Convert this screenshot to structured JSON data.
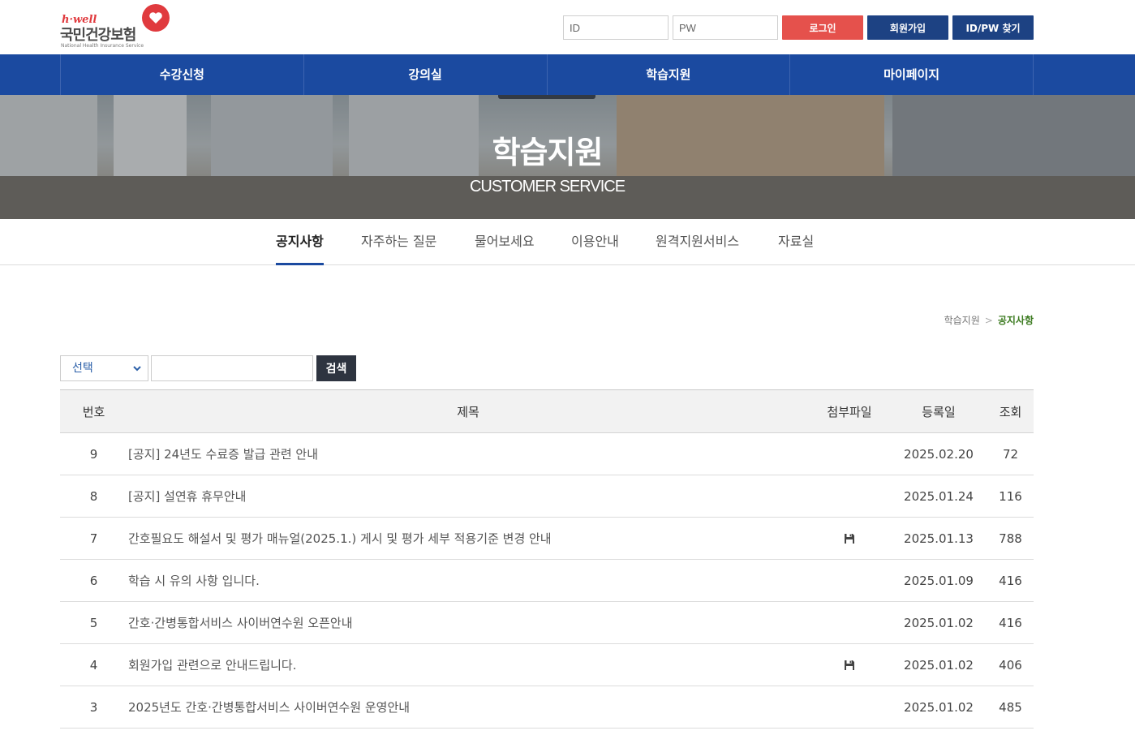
{
  "logo": {
    "brand": "h·well",
    "name": "국민건강보험",
    "sub": "National Health Insurance Service"
  },
  "login": {
    "id_placeholder": "ID",
    "pw_placeholder": "PW",
    "login_label": "로그인",
    "signup_label": "회원가입",
    "find_label": "ID/PW 찾기"
  },
  "gnb": {
    "items": [
      {
        "label": "수강신청"
      },
      {
        "label": "강의실"
      },
      {
        "label": "학습지원"
      },
      {
        "label": "마이페이지"
      }
    ]
  },
  "banner": {
    "title": "학습지원",
    "subtitle": "CUSTOMER SERVICE"
  },
  "subtabs": {
    "items": [
      {
        "label": "공지사항",
        "active": true
      },
      {
        "label": "자주하는 질문"
      },
      {
        "label": "물어보세요"
      },
      {
        "label": "이용안내"
      },
      {
        "label": "원격지원서비스"
      },
      {
        "label": "자료실"
      }
    ]
  },
  "breadcrumb": {
    "parent": "학습지원",
    "separator": ">",
    "current": "공지사항"
  },
  "search": {
    "select_value": "선택",
    "input_value": "",
    "button_label": "검색"
  },
  "table": {
    "headers": {
      "no": "번호",
      "title": "제목",
      "file": "첨부파일",
      "date": "등록일",
      "views": "조회"
    },
    "rows": [
      {
        "no": "9",
        "title": "[공지] 24년도 수료증 발급 관련 안내",
        "has_file": false,
        "date": "2025.02.20",
        "views": "72"
      },
      {
        "no": "8",
        "title": "[공지] 설연휴 휴무안내",
        "has_file": false,
        "date": "2025.01.24",
        "views": "116"
      },
      {
        "no": "7",
        "title": "간호필요도 해설서 및 평가 매뉴얼(2025.1.) 게시 및 평가 세부 적용기준 변경 안내",
        "has_file": true,
        "date": "2025.01.13",
        "views": "788"
      },
      {
        "no": "6",
        "title": "학습 시 유의 사항 입니다.",
        "has_file": false,
        "date": "2025.01.09",
        "views": "416"
      },
      {
        "no": "5",
        "title": "간호·간병통합서비스 사이버연수원 오픈안내",
        "has_file": false,
        "date": "2025.01.02",
        "views": "416"
      },
      {
        "no": "4",
        "title": "회원가입 관련으로 안내드립니다.",
        "has_file": true,
        "date": "2025.01.02",
        "views": "406"
      },
      {
        "no": "3",
        "title": "2025년도 간호·간병통합서비스 사이버연수원 운영안내",
        "has_file": false,
        "date": "2025.01.02",
        "views": "485"
      }
    ]
  },
  "colors": {
    "gnb": "#1b4aa0",
    "login_button": "#e5514c",
    "navy_button": "#1d4283",
    "breadcrumb_current": "#3b7a1f",
    "search_button": "#2e3440"
  },
  "icons": {
    "file": "floppy-disk-icon",
    "select": "chevron-down-icon",
    "logo": "heart-icon"
  }
}
